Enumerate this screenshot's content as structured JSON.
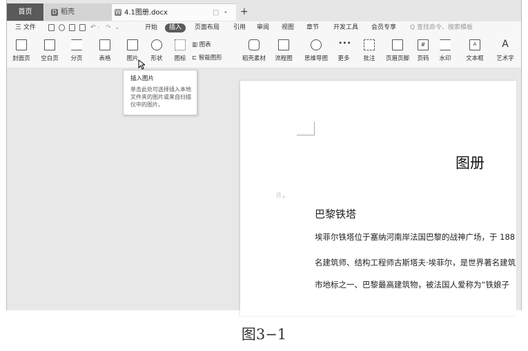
{
  "tabs": {
    "home": "首页",
    "docer": "稻壳",
    "doc": "4.1图册.docx",
    "new_tab": "+"
  },
  "menu": {
    "file": "三 文件",
    "items": [
      "开始",
      "插入",
      "页面布局",
      "引用",
      "审阅",
      "视图",
      "章节",
      "开发工具",
      "会员专享"
    ],
    "active": "插入",
    "search": "Q 查找命令、搜索模板"
  },
  "ribbon": {
    "cover": "封面页",
    "blank": "空白页",
    "pagebreak": "分页",
    "table": "表格",
    "picture": "图片",
    "shape": "形状",
    "icon": "图标",
    "chart": "图表",
    "smartart": "智能图形",
    "docer_material": "稻壳素材",
    "flowchart": "流程图",
    "mindmap": "思维导图",
    "more": "更多",
    "comment": "批注",
    "header_footer": "页眉页脚",
    "page_number": "页码",
    "watermark": "水印",
    "textbox": "文本框",
    "wordart": "艺术字"
  },
  "tooltip": {
    "title": "插入图片",
    "body": "单击此处可选择插入本地文件夹的图片或来自扫描仪中的图片。"
  },
  "document": {
    "title": "图册",
    "heading": "巴黎铁塔",
    "para1": "埃菲尔铁塔位于塞纳河南岸法国巴黎的战神广场，于 188",
    "para2": "名建筑师、结构工程师古斯塔夫·埃菲尔，是世界著名建筑",
    "para3": "市地标之一、巴黎最高建筑物，被法国人爱称为“铁娘子"
  },
  "caption": "图3−1"
}
